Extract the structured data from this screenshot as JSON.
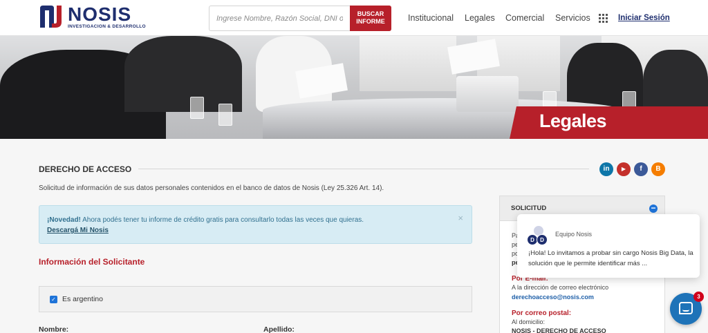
{
  "header": {
    "logo": {
      "brand": "NOSIS",
      "subtitle": "INVESTIGACION & DESARROLLO"
    },
    "search": {
      "placeholder": "Ingrese Nombre, Razón Social, DNI o CUIT",
      "button_line1": "BUSCAR",
      "button_line2": "INFORME"
    },
    "nav": [
      "Institucional",
      "Legales",
      "Comercial",
      "Servicios"
    ],
    "apps_icon": "grid-icon",
    "login": "Iniciar Sesión"
  },
  "banner": {
    "title": "Legales",
    "accent": "#b7202a"
  },
  "page": {
    "section_title": "DERECHO DE ACCESO",
    "intro": "Solicitud de información de sus datos personales contenidos en el banco de datos de Nosis (Ley 25.326 Art. 14).",
    "social": [
      {
        "name": "linkedin-icon",
        "glyph": "in",
        "color": "#0e76a8"
      },
      {
        "name": "youtube-icon",
        "glyph": "▶",
        "color": "#c4302b"
      },
      {
        "name": "facebook-icon",
        "glyph": "f",
        "color": "#3b5998"
      },
      {
        "name": "blogger-icon",
        "glyph": "B",
        "color": "#f57d00"
      }
    ],
    "alert": {
      "strong": "¡Novedad!",
      "text": " Ahora podés tener tu informe de crédito gratis para consultarlo todas las veces que quieras.",
      "link": "Descargá Mi Nosis",
      "close": "×"
    },
    "form": {
      "title": "Información del Solicitante",
      "checkbox_label": "Es argentino",
      "checkbox_checked": true,
      "name_label": "Nombre:",
      "surname_label": "Apellido:"
    }
  },
  "panel": {
    "title": "SOLICITUD",
    "partial_lines": [
      "Pa",
      "pe",
      "po",
      "pe"
    ],
    "email_heading": "Por E-mail:",
    "email_text": "A la dirección de correo electrónico",
    "email_address": "derechoacceso@nosis.com",
    "mail_heading": "Por correo postal:",
    "mail_text": "Al domicilio:",
    "mail_address": "NOSIS - DERECHO DE ACCESO"
  },
  "chat": {
    "team": "Equipo Nosis",
    "avatar_letters": [
      "D",
      "D"
    ],
    "message": "¡Hola! Lo invitamos a probar sin cargo Nosis Big Data, la solución que le permite identificar más ...",
    "unread": "3"
  }
}
